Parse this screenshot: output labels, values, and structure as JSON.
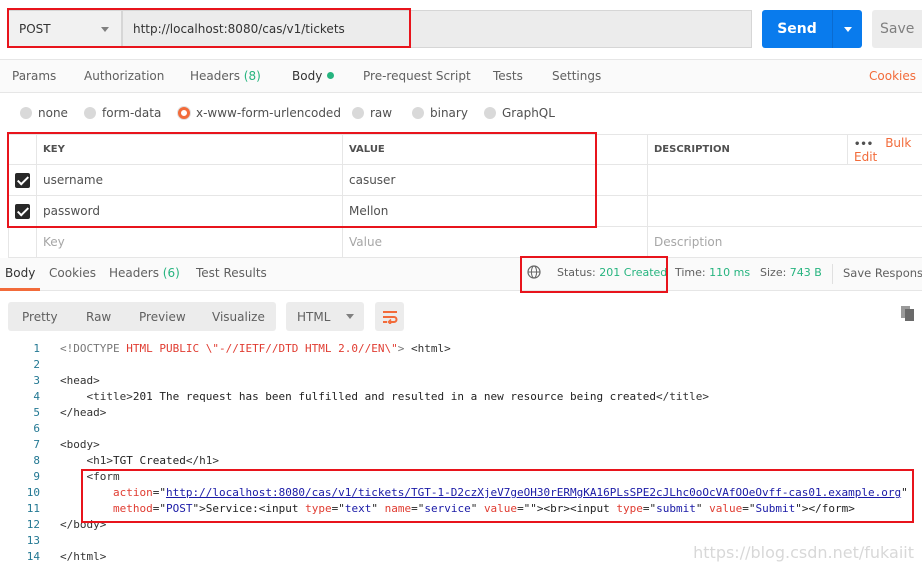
{
  "request": {
    "method": "POST",
    "url": "http://localhost:8080/cas/v1/tickets",
    "send_label": "Send",
    "save_label": "Save"
  },
  "tabs": [
    {
      "label": "Params"
    },
    {
      "label": "Authorization"
    },
    {
      "label": "Headers",
      "count": "(8)"
    },
    {
      "label": "Body"
    },
    {
      "label": "Pre-request Script"
    },
    {
      "label": "Tests"
    },
    {
      "label": "Settings"
    }
  ],
  "cookies_label": "Cookies",
  "body_types": [
    "none",
    "form-data",
    "x-www-form-urlencoded",
    "raw",
    "binary",
    "GraphQL"
  ],
  "body_type_selected": "x-www-form-urlencoded",
  "table": {
    "headers": {
      "key": "KEY",
      "value": "VALUE",
      "description": "DESCRIPTION",
      "more": "•••",
      "bulk": "Bulk Edit"
    },
    "rows": [
      {
        "key": "username",
        "value": "casuser",
        "checked": true
      },
      {
        "key": "password",
        "value": "Mellon",
        "checked": true
      }
    ],
    "placeholder": {
      "key": "Key",
      "value": "Value",
      "description": "Description"
    }
  },
  "response": {
    "tabs": [
      {
        "label": "Body"
      },
      {
        "label": "Cookies"
      },
      {
        "label": "Headers",
        "count": "(6)"
      },
      {
        "label": "Test Results"
      }
    ],
    "status_label": "Status:",
    "status": "201 Created",
    "time_label": "Time:",
    "time": "110 ms",
    "size_label": "Size:",
    "size": "743 B",
    "save_label": "Save Response",
    "views": [
      "Pretty",
      "Raw",
      "Preview",
      "Visualize"
    ],
    "format": "HTML"
  },
  "code_lines": [
    [
      [
        "k-gray",
        "<!DOCTYPE "
      ],
      [
        "k-attr",
        "HTML PUBLIC \\\"-//IETF//DTD HTML 2.0//EN\\\""
      ],
      [
        "k-gray",
        ">"
      ],
      [
        "k-tag",
        " <html>"
      ]
    ],
    [],
    [
      [
        "k-tag",
        "<head>"
      ]
    ],
    [
      [
        "k-tag",
        "    <title>"
      ],
      [
        "k-txt",
        "201 The request has been fulfilled and resulted in a new resource being created"
      ],
      [
        "k-tag",
        "</title>"
      ]
    ],
    [
      [
        "k-tag",
        "</head>"
      ]
    ],
    [],
    [
      [
        "k-tag",
        "<body>"
      ]
    ],
    [
      [
        "k-tag",
        "    <h1>"
      ],
      [
        "k-txt",
        "TGT Created"
      ],
      [
        "k-tag",
        "</h1>"
      ]
    ],
    [
      [
        "k-tag",
        "    <form"
      ]
    ],
    [
      [
        "k-txt",
        "        "
      ],
      [
        "k-attr",
        "action"
      ],
      [
        "k-txt",
        "=\""
      ],
      [
        "k-url",
        "http://localhost:8080/cas/v1/tickets/TGT-1-D2czXjeV7geOH30rERMgKA16PLsSPE2cJLhc0oOcVAfOOeOvff-cas01.example.org"
      ],
      [
        "k-txt",
        "\""
      ]
    ],
    [
      [
        "k-txt",
        "        "
      ],
      [
        "k-attr",
        "method"
      ],
      [
        "k-txt",
        "=\""
      ],
      [
        "k-val",
        "POST"
      ],
      [
        "k-txt",
        "\">Service:<input "
      ],
      [
        "k-attr",
        "type"
      ],
      [
        "k-txt",
        "=\""
      ],
      [
        "k-val",
        "text"
      ],
      [
        "k-txt",
        "\" "
      ],
      [
        "k-attr",
        "name"
      ],
      [
        "k-txt",
        "=\""
      ],
      [
        "k-val",
        "service"
      ],
      [
        "k-txt",
        "\" "
      ],
      [
        "k-attr",
        "value"
      ],
      [
        "k-txt",
        "=\"\"><br><input "
      ],
      [
        "k-attr",
        "type"
      ],
      [
        "k-txt",
        "=\""
      ],
      [
        "k-val",
        "submit"
      ],
      [
        "k-txt",
        "\" "
      ],
      [
        "k-attr",
        "value"
      ],
      [
        "k-txt",
        "=\""
      ],
      [
        "k-val",
        "Submit"
      ],
      [
        "k-txt",
        "\"></form>"
      ]
    ],
    [
      [
        "k-tag",
        "</body>"
      ]
    ],
    [],
    [
      [
        "k-tag",
        "</html>"
      ]
    ]
  ],
  "watermark": "https://blog.csdn.net/fukaiit",
  "colors": {
    "accent": "#f26b3a",
    "send": "#097bed",
    "success": "#26b47f",
    "highlight": "#e8141c"
  }
}
